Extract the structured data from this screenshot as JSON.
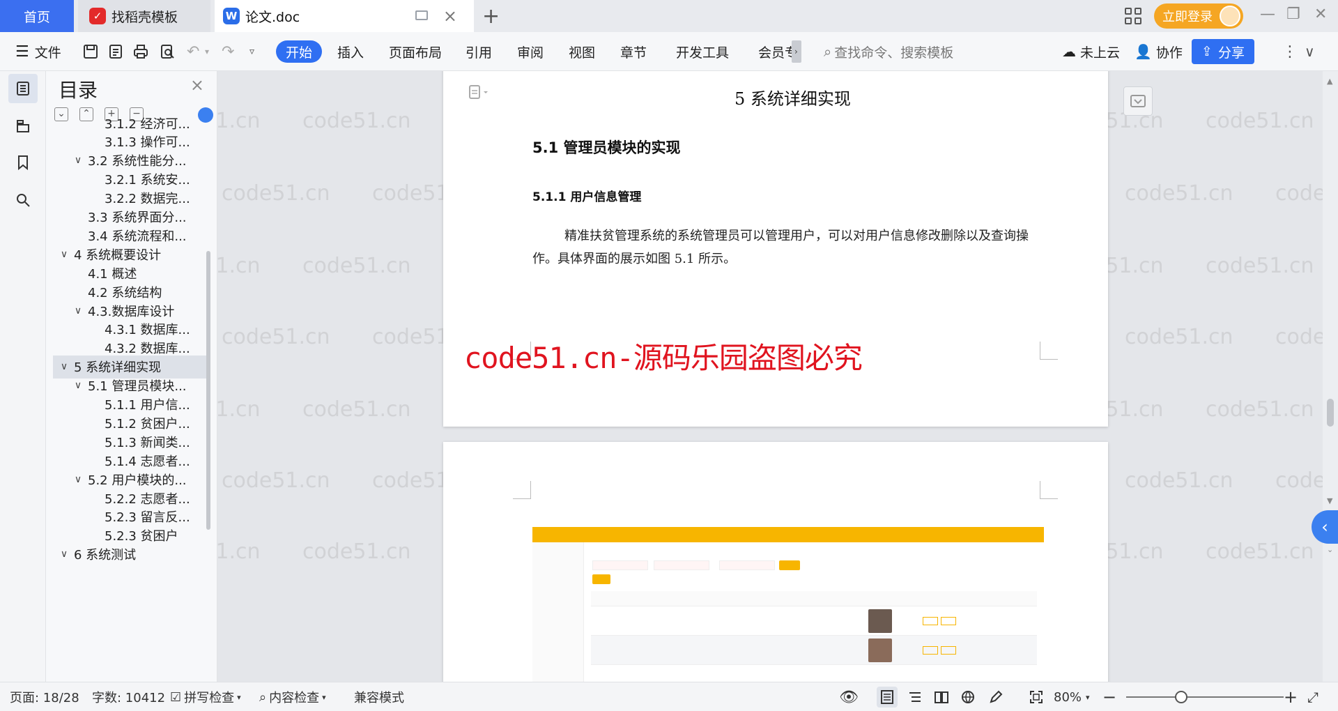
{
  "tabs": {
    "home": "首页",
    "daoke": "找稻壳模板",
    "doc": "论文.doc",
    "doc_icon": "W"
  },
  "header": {
    "login": "立即登录"
  },
  "ribbon": {
    "file": "文件",
    "start": "开始",
    "insert": "插入",
    "layout": "页面布局",
    "reference": "引用",
    "review": "审阅",
    "view": "视图",
    "chapter": "章节",
    "devtools": "开发工具",
    "member": "会员专",
    "search_placeholder": "查找命令、搜索模板",
    "cloud": "未上云",
    "collab": "协作",
    "share": "分享"
  },
  "toc": {
    "title": "目录",
    "items": [
      {
        "label": "3.1.2 经济可...",
        "level": 3,
        "chev": ""
      },
      {
        "label": "3.1.3 操作可...",
        "level": 3,
        "chev": ""
      },
      {
        "label": "3.2 系统性能分...",
        "level": 2,
        "chev": "∨"
      },
      {
        "label": "3.2.1  系统安...",
        "level": 3,
        "chev": ""
      },
      {
        "label": "3.2.2  数据完...",
        "level": 3,
        "chev": ""
      },
      {
        "label": "3.3 系统界面分...",
        "level": 2,
        "chev": ""
      },
      {
        "label": "3.4 系统流程和...",
        "level": 2,
        "chev": ""
      },
      {
        "label": "4 系统概要设计",
        "level": 1,
        "chev": "∨"
      },
      {
        "label": "4.1 概述",
        "level": 2,
        "chev": ""
      },
      {
        "label": "4.2 系统结构",
        "level": 2,
        "chev": ""
      },
      {
        "label": "4.3.数据库设计",
        "level": 2,
        "chev": "∨"
      },
      {
        "label": "4.3.1 数据库...",
        "level": 3,
        "chev": ""
      },
      {
        "label": "4.3.2 数据库...",
        "level": 3,
        "chev": ""
      },
      {
        "label": "5 系统详细实现",
        "level": 1,
        "chev": "∨",
        "selected": true
      },
      {
        "label": "5.1  管理员模块...",
        "level": 2,
        "chev": "∨"
      },
      {
        "label": "5.1.1  用户信...",
        "level": 3,
        "chev": ""
      },
      {
        "label": "5.1.2  贫困户...",
        "level": 3,
        "chev": ""
      },
      {
        "label": "5.1.3  新闻类...",
        "level": 3,
        "chev": ""
      },
      {
        "label": "5.1.4  志愿者...",
        "level": 3,
        "chev": ""
      },
      {
        "label": "5.2  用户模块的...",
        "level": 2,
        "chev": "∨"
      },
      {
        "label": "5.2.2  志愿者...",
        "level": 3,
        "chev": ""
      },
      {
        "label": "5.2.3  留言反...",
        "level": 3,
        "chev": ""
      },
      {
        "label": "5.2.3  贫困户",
        "level": 3,
        "chev": ""
      },
      {
        "label": "6 系统测试",
        "level": 1,
        "chev": "∨"
      }
    ]
  },
  "document": {
    "chapter_title": "5 系统详细实现",
    "section_title": "5.1  管理员模块的实现",
    "subsection_title": "5.1.1  用户信息管理",
    "paragraph": "精准扶贫管理系统的系统管理员可以管理用户，可以对用户信息修改删除以及查询操作。具体界面的展示如图 5.1 所示。",
    "banner": "code51.cn-源码乐园盗图必究",
    "watermark": "code51.cn"
  },
  "statusbar": {
    "page": "页面: 18/28",
    "words": "字数: 10412",
    "spell": "拼写检查",
    "content_check": "内容检查",
    "compat": "兼容模式",
    "zoom": "80%"
  },
  "colors": {
    "accent": "#2f6ff2",
    "login": "#f5a623",
    "banner_red": "#e0141f",
    "app_yellow": "#f7b500"
  }
}
